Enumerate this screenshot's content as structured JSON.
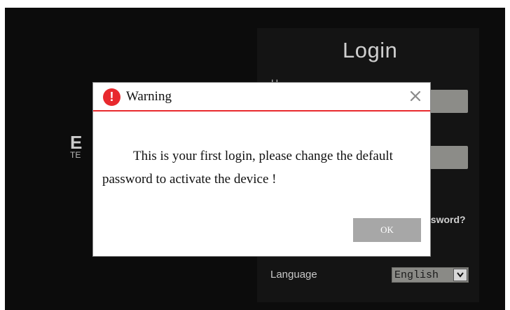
{
  "login": {
    "title": "Login",
    "user_label_stub": "U",
    "forgot_partial": "ssword?",
    "language_label": "Language",
    "language_value": "English"
  },
  "brand": {
    "mark": "E",
    "sub": "TE"
  },
  "dialog": {
    "icon": "warning-exclamation-icon",
    "title": "Warning",
    "message": "This is your first login, please change the default password to activate the device !",
    "ok_label": "OK",
    "accent_color": "#e8292e"
  }
}
